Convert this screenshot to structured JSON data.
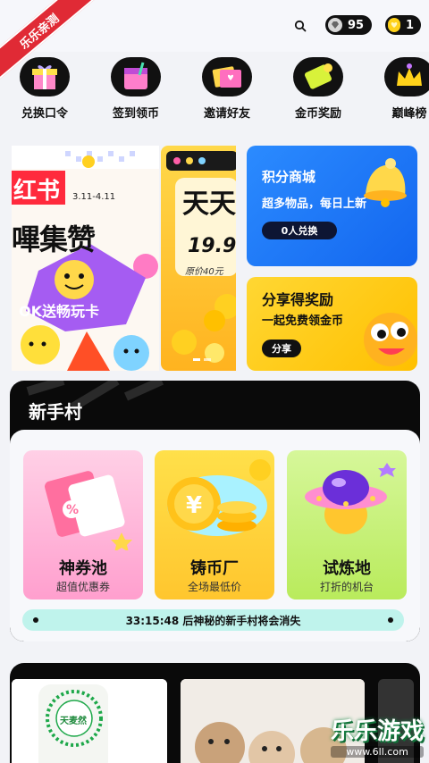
{
  "header": {
    "title": "",
    "diamond_count": "95",
    "coin_count": "1"
  },
  "ribbon_text": "乐乐亲测",
  "quick_nav": [
    {
      "label": "兑换口令",
      "icon": "gift-icon"
    },
    {
      "label": "签到领币",
      "icon": "calendar-icon"
    },
    {
      "label": "邀请好友",
      "icon": "invite-envelope-icon"
    },
    {
      "label": "金币奖励",
      "icon": "coin-ticket-icon"
    },
    {
      "label": "巅峰榜",
      "icon": "crown-icon"
    }
  ],
  "banner_a": {
    "line1": "红书",
    "dates": "3.11-4.11",
    "line2": "嗶集赞",
    "line3": "OK送畅玩卡"
  },
  "banner_b": {
    "headline": "天天",
    "price": "19.9",
    "original_price": "原价40元"
  },
  "points_mall": {
    "title": "积分商城",
    "subtitle": "超多物品，每日上新",
    "button": "0人兑换"
  },
  "share_reward": {
    "title": "分享得奖励",
    "subtitle": "一起免费领金币",
    "button": "分享"
  },
  "novice": {
    "title": "新手村",
    "cards": [
      {
        "title": "神券池",
        "subtitle": "超值优惠券"
      },
      {
        "title": "铸币厂",
        "subtitle": "全场最低价"
      },
      {
        "title": "试炼地",
        "subtitle": "打折的机台"
      }
    ],
    "timer_text": "33:15:48 后神秘的新手村将会消失"
  },
  "feed": {
    "product_label": "天麦然"
  },
  "watermark": {
    "title": "乐乐游戏",
    "url": "www.6ll.com"
  },
  "colors": {
    "blue_card": "#1e7cf8",
    "yellow_card": "#ffcd1f",
    "pink_card": "#ffb8d9",
    "orange_card": "#ffd94a",
    "green_card": "#c4f07a",
    "timer_bg": "#bff3ec"
  }
}
